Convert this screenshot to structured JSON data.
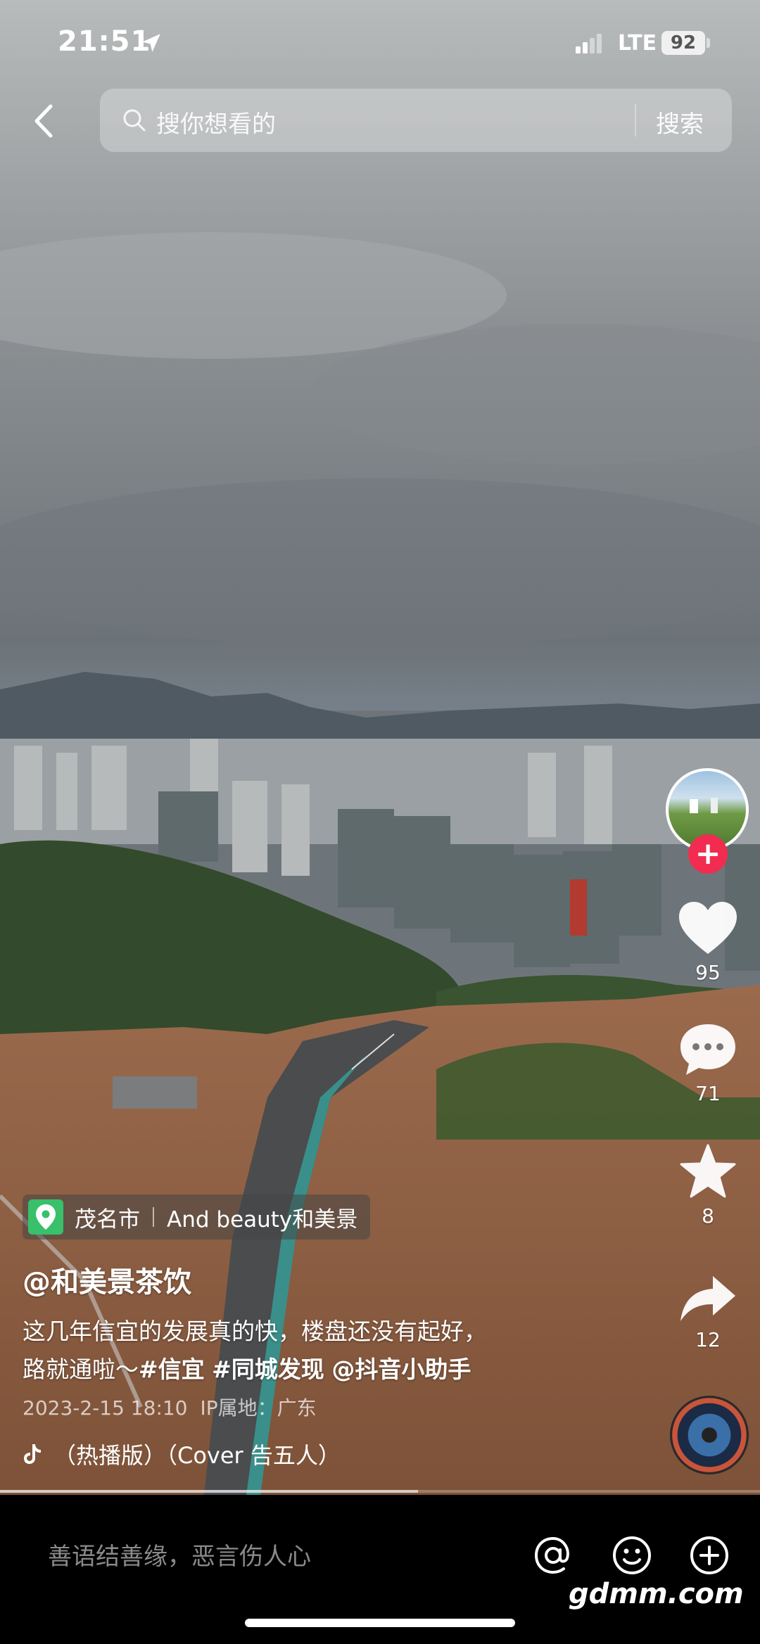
{
  "status_bar": {
    "time": "21:51",
    "network": "LTE",
    "battery": "92"
  },
  "search": {
    "placeholder": "搜你想看的",
    "button_label": "搜索"
  },
  "actions": {
    "likes": "95",
    "comments": "71",
    "favorites": "8",
    "shares": "12"
  },
  "video": {
    "poi_city": "茂名市",
    "poi_name": "And beauty和美景",
    "author": "@和美景茶饮",
    "description_line1": "这几年信宜的发展真的快，楼盘还没有起好，",
    "description_line2_text": "路就通啦～",
    "tags": [
      "#信宜",
      "#同城发现",
      "@抖音小助手"
    ],
    "date": "2023-2-15 18:10",
    "ip_location": "IP属地：广东",
    "music": "（热播版）（Cover 告五人）",
    "progress": 0.55
  },
  "comment_bar": {
    "placeholder": "善语结善缘，恶言伤人心"
  },
  "watermark": "gdmm.com",
  "colors": {
    "follow_red": "#f22c50",
    "poi_green": "#38c06a"
  },
  "icons": [
    "location-arrow-icon",
    "signal-icon",
    "back-icon",
    "search-icon",
    "heart-icon",
    "comment-icon",
    "star-icon",
    "share-icon",
    "douyin-note-icon",
    "at-icon",
    "emoji-icon",
    "plus-icon"
  ]
}
